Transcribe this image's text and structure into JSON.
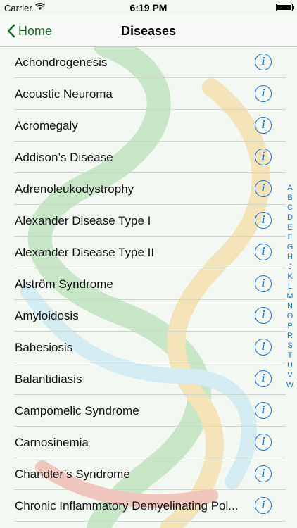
{
  "status": {
    "carrier": "Carrier",
    "time": "6:19 PM"
  },
  "nav": {
    "back_label": "Home",
    "title": "Diseases"
  },
  "rows": [
    {
      "label": "Achondrogenesis"
    },
    {
      "label": "Acoustic Neuroma"
    },
    {
      "label": "Acromegaly"
    },
    {
      "label": "Addison’s Disease"
    },
    {
      "label": "Adrenoleukodystrophy"
    },
    {
      "label": "Alexander Disease Type I"
    },
    {
      "label": "Alexander Disease Type II"
    },
    {
      "label": "Alström Syndrome"
    },
    {
      "label": "Amyloidosis"
    },
    {
      "label": "Babesiosis"
    },
    {
      "label": "Balantidiasis"
    },
    {
      "label": "Campomelic Syndrome"
    },
    {
      "label": "Carnosinemia"
    },
    {
      "label": "Chandler’s Syndrome"
    },
    {
      "label": "Chronic Inflammatory Demyelinating Pol..."
    }
  ],
  "info_glyph": "i",
  "index_letters": [
    "A",
    "B",
    "C",
    "D",
    "E",
    "F",
    "G",
    "H",
    "J",
    "K",
    "L",
    "M",
    "N",
    "O",
    "P",
    "R",
    "S",
    "T",
    "U",
    "V",
    "W"
  ],
  "icons": {
    "back": "chevron-left-icon",
    "info": "info-circle-icon",
    "wifi": "wifi-icon",
    "battery": "battery-icon"
  },
  "colors": {
    "accent": "#1c6fd6",
    "nav_tint": "#1a6b2b",
    "background": "#f3f8f3"
  }
}
